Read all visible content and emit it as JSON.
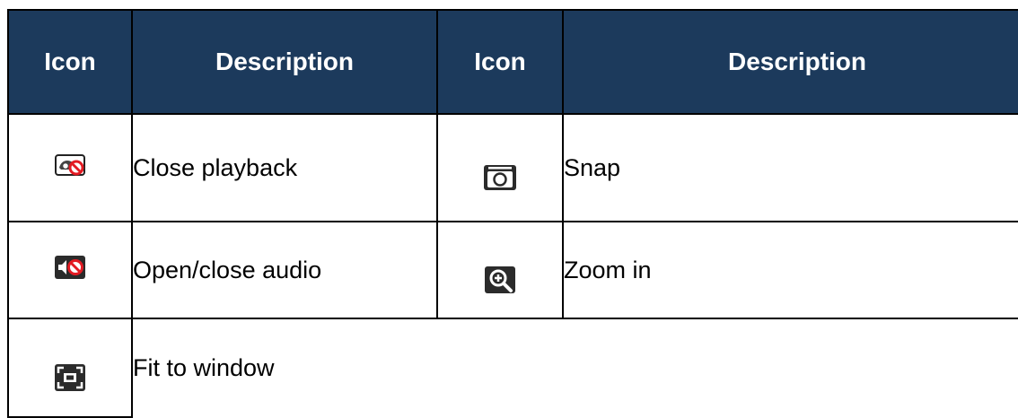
{
  "table": {
    "headers": [
      "Icon",
      "Description",
      "Icon",
      "Description"
    ],
    "rows": [
      [
        {
          "icon": "close-playback-icon",
          "description": "Close playback"
        },
        {
          "icon": "snap-camera-icon",
          "description": "Snap"
        }
      ],
      [
        {
          "icon": "audio-muted-icon",
          "description": "Open/close audio"
        },
        {
          "icon": "zoom-in-icon",
          "description": "Zoom in"
        }
      ],
      [
        {
          "icon": "fit-to-window-icon",
          "description": "Fit to window"
        }
      ]
    ]
  },
  "colors": {
    "header_bg": "#1c3a5c",
    "header_text": "#ffffff",
    "border": "#000000",
    "icon_red": "#e31b23"
  }
}
